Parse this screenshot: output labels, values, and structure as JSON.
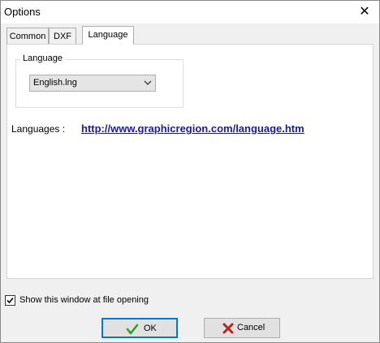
{
  "window": {
    "title": "Options"
  },
  "tabs": [
    {
      "label": "Common",
      "active": false
    },
    {
      "label": "DXF",
      "active": false
    },
    {
      "label": "Language",
      "active": true
    }
  ],
  "language_group": {
    "legend": "Language",
    "select_value": "English.lng"
  },
  "languages": {
    "label": "Languages :",
    "link": "http://www.graphicregion.com/language.htm"
  },
  "footer": {
    "checkbox_label": "Show this window at file opening",
    "checkbox_checked": true,
    "ok_label": "OK",
    "cancel_label": "Cancel"
  },
  "icons": {
    "close": "close-icon",
    "dropdown": "chevron-down-icon",
    "ok": "checkmark-icon",
    "cancel": "x-icon"
  },
  "colors": {
    "link": "#1a1a9b",
    "ok_check": "#2e9e2e",
    "cancel_x": "#b3261e",
    "focus_border": "#0078d7"
  }
}
